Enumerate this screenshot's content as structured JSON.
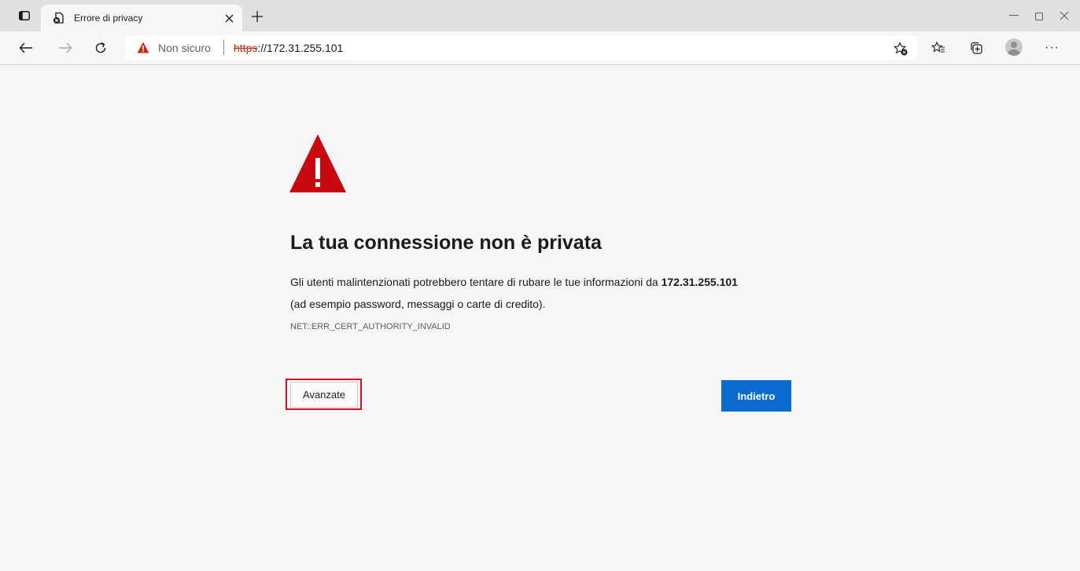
{
  "colors": {
    "warning_red": "#c42b1c",
    "highlight_red": "#d7141e",
    "primary_blue": "#0a6ad0",
    "page_background": "#f6f6f6"
  },
  "tabstrip": {
    "tab_actions_icon": "tab-actions-icon",
    "tabs": [
      {
        "title": "Errore di privacy",
        "favicon": "error-page-favicon-icon",
        "close_label": "×"
      }
    ],
    "new_tab_label": "+",
    "window_controls": {
      "minimize": "—",
      "restore": "▢",
      "close": "✕"
    }
  },
  "toolbar": {
    "back_icon": "←",
    "forward_icon": "→",
    "refresh_icon": "C",
    "address": {
      "security_label": "Non sicuro",
      "url_scheme": "https",
      "url_rest": "://172.31.255.101"
    },
    "more_label": "···"
  },
  "page": {
    "headline": "La tua connessione non è privata",
    "description_prefix": "Gli utenti malintenzionati potrebbero tentare di rubare le tue informazioni da ",
    "description_host": "172.31.255.101",
    "description_suffix": "(ad esempio password, messaggi o carte di credito).",
    "error_code": "NET::ERR_CERT_AUTHORITY_INVALID",
    "advanced_button_label": "Avanzate",
    "back_button_label": "Indietro"
  }
}
